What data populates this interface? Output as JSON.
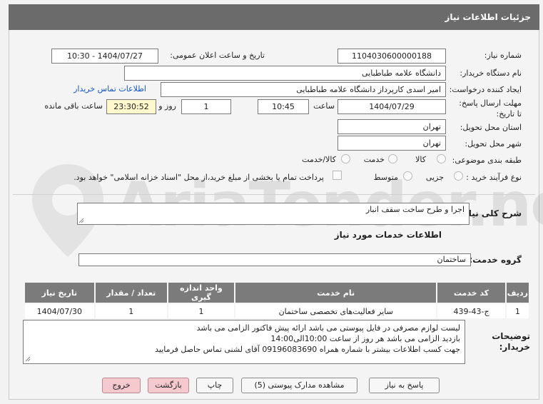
{
  "title": "جزئیات اطلاعات نیاز",
  "watermark": "AriaTender.neT",
  "fields": {
    "need_number_label": "شماره نیاز:",
    "need_number": "1104030600000188",
    "announce_label": "تاریخ و ساعت اعلان عمومی:",
    "announce_value": "1404/07/27 - 10:30",
    "buyer_org_label": "نام دستگاه خریدار:",
    "buyer_org": "دانشگاه علامه طباطبایی",
    "creator_label": "ایجاد کننده درخواست:",
    "creator": "امیر اسدی کارپرداز دانشگاه علامه طباطبایی",
    "contact_link": "اطلاعات تماس خریدار",
    "deadline_label": "مهلت ارسال پاسخ: تا تاریخ:",
    "deadline_date": "1404/07/29",
    "time_label": "ساعت",
    "deadline_time": "10:45",
    "days_value": "1",
    "days_label": "روز و",
    "remaining_time": "23:30:52",
    "remaining_label": "ساعت باقی مانده",
    "province_label": "استان محل تحویل:",
    "province": "تهران",
    "city_label": "شهر محل تحویل:",
    "city": "تهران",
    "category_label": "طبقه بندی موضوعی:",
    "category_options": [
      "کالا",
      "خدمت",
      "کالا/خدمت"
    ],
    "process_label": "نوع فرآیند خرید :",
    "process_options": [
      "جزیی",
      "متوسط"
    ],
    "payment_note": "پرداخت تمام یا بخشی از مبلغ خرید،از محل \"اسناد خزانه اسلامی\" خواهد بود."
  },
  "summary": {
    "label": "شرح کلی نیاز:",
    "value": "اجرا و طرح ساخت سقف انبار"
  },
  "services": {
    "heading": "اطلاعات خدمات مورد نیاز",
    "group_label": "گروه خدمت:",
    "group_value": "ساختمان",
    "columns": [
      "ردیف",
      "کد خدمت",
      "نام خدمت",
      "واحد اندازه گیری",
      "تعداد / مقدار",
      "تاریخ نیاز"
    ],
    "rows": [
      [
        "1",
        "ج-43-439",
        "سایر فعالیت‌های تخصصی ساختمان",
        "1",
        "1",
        "1404/07/30"
      ]
    ]
  },
  "buyer_notes": {
    "label": "توضیحات خریدار:",
    "lines": [
      "لیست لوازم مصرفی در فایل پیوستی می باشد                   ارائه پیش فاکتور الزامی می باشد",
      "بازدید الزامی می باشد هر روز از ساعت 10:00الی14:00",
      "جهت کسب اطلاعات بیشتر با شماره همراه 09196083690 آقای لشنی تماس حاصل فرمایید"
    ]
  },
  "buttons": {
    "reply": "پاسخ به نیاز",
    "attachments": "مشاهده مدارک پیوستی (5)",
    "print": "چاپ",
    "back": "بازگشت",
    "exit": "خروج"
  },
  "colors": {
    "titlebar": "#6b6b6b",
    "link": "#1155cc",
    "pink_button": "#f6c9cf",
    "highlight": "#fff8cc"
  }
}
